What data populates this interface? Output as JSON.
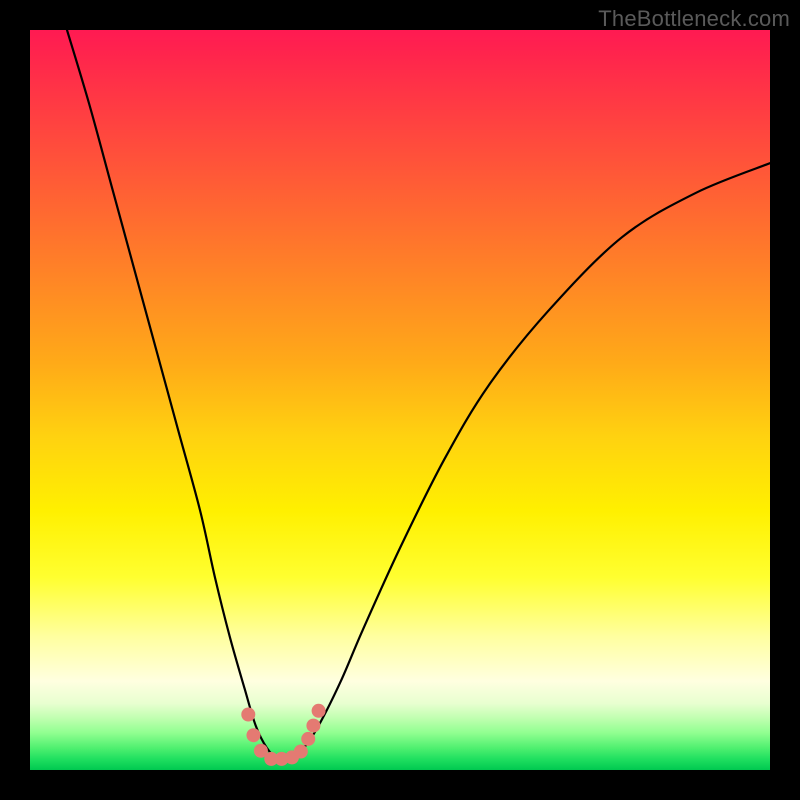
{
  "watermark_text": "TheBottleneck.com",
  "chart_data": {
    "type": "line",
    "title": "",
    "xlabel": "",
    "ylabel": "",
    "xlim": [
      0,
      100
    ],
    "ylim": [
      0,
      100
    ],
    "series": [
      {
        "name": "bottleneck-curve",
        "x": [
          5,
          8,
          11,
          14,
          17,
          20,
          23,
          25,
          27,
          29,
          30.5,
          32,
          33.5,
          35,
          37,
          39,
          42,
          45,
          50,
          56,
          62,
          70,
          80,
          90,
          100
        ],
        "y": [
          100,
          90,
          79,
          68,
          57,
          46,
          35,
          26,
          18,
          11,
          6,
          3,
          1.5,
          1.5,
          3,
          6,
          12,
          19,
          30,
          42,
          52,
          62,
          72,
          78,
          82
        ]
      },
      {
        "name": "bottleneck-markers",
        "x": [
          29.5,
          30.2,
          31.2,
          32.6,
          34.0,
          35.4,
          36.6,
          37.6,
          38.3,
          39.0
        ],
        "y": [
          7.5,
          4.7,
          2.6,
          1.5,
          1.5,
          1.7,
          2.5,
          4.2,
          6.0,
          8.0
        ]
      }
    ],
    "gradient_stops": [
      {
        "pos": 0.0,
        "color": "#ff1a52"
      },
      {
        "pos": 0.5,
        "color": "#ffd210"
      },
      {
        "pos": 0.82,
        "color": "#ffffa0"
      },
      {
        "pos": 1.0,
        "color": "#00c850"
      }
    ]
  }
}
